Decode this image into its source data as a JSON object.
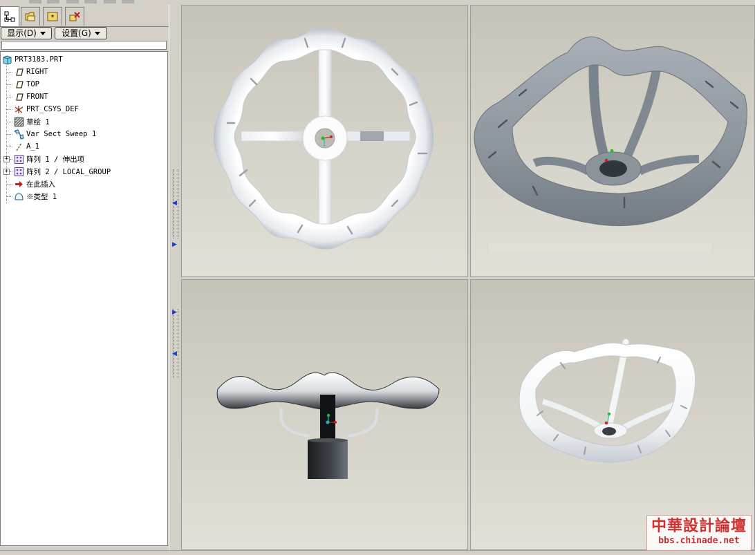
{
  "navigator": {
    "tabs": [
      "model-tree",
      "folder-browser",
      "favorites",
      "connections"
    ],
    "show_menu": "显示(D)",
    "settings_menu": "设置(G)",
    "tree": [
      {
        "label": "PRT3183.PRT",
        "icon": "part-icon",
        "expandable": false
      },
      {
        "label": "RIGHT",
        "icon": "datum-plane-icon",
        "expandable": false
      },
      {
        "label": "TOP",
        "icon": "datum-plane-icon",
        "expandable": false
      },
      {
        "label": "FRONT",
        "icon": "datum-plane-icon",
        "expandable": false
      },
      {
        "label": "PRT_CSYS_DEF",
        "icon": "coordinate-system-icon",
        "expandable": false
      },
      {
        "label": "草绘 1",
        "icon": "sketch-icon",
        "expandable": false
      },
      {
        "label": "Var Sect Sweep 1",
        "icon": "sweep-icon",
        "expandable": false
      },
      {
        "label": "A_1",
        "icon": "datum-axis-icon",
        "expandable": false
      },
      {
        "label": "阵列 1 / 伸出项",
        "icon": "pattern-icon",
        "expandable": true
      },
      {
        "label": "阵列 2 / LOCAL_GROUP",
        "icon": "pattern-icon",
        "expandable": true
      },
      {
        "label": "在此插入",
        "icon": "insert-here-arrow-icon",
        "expandable": false
      },
      {
        "label": "※类型 1",
        "icon": "surface-icon",
        "expandable": false
      }
    ]
  },
  "viewports": {
    "count": 4,
    "views": [
      "top-view",
      "isometric-view",
      "side-view",
      "perspective-view"
    ],
    "model_color": "#ffffff",
    "shaded_color": "#8e959c"
  },
  "watermark": {
    "chinese": "中華設計論壇",
    "url": "bbs.chinade.net"
  }
}
